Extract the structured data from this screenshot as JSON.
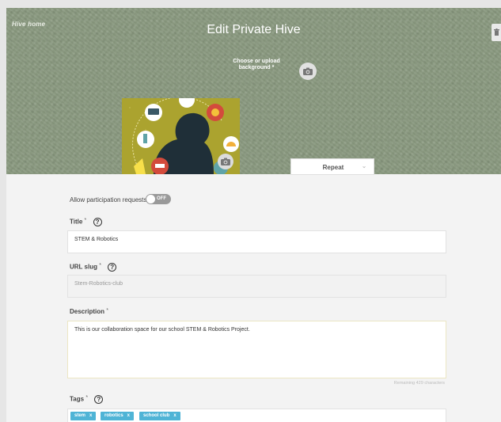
{
  "header": {
    "back_link": "Hive home",
    "title": "Edit Private Hive",
    "background_label": "Choose or upload background",
    "background_required": "*",
    "repeat_value": "Repeat"
  },
  "form": {
    "allow_participation": {
      "label": "Allow participation requests",
      "toggle_text": "OFF"
    },
    "title": {
      "label": "Title",
      "required": "*",
      "help": "?",
      "value": "STEM & Robotics"
    },
    "url_slug": {
      "label": "URL slug",
      "required": "*",
      "help": "?",
      "value": "Stem-Robotics-club"
    },
    "description": {
      "label": "Description",
      "required": "*",
      "value": "This is our collaboration space for our school STEM & Robotics Project.",
      "remaining": "Remaining 429 characters"
    },
    "tags": {
      "label": "Tags",
      "required": "*",
      "help": "?",
      "items": [
        {
          "label": "stem",
          "remove": "x"
        },
        {
          "label": "robotics",
          "remove": "x"
        },
        {
          "label": "school club",
          "remove": "x"
        }
      ]
    }
  },
  "colors": {
    "header_bg": "#8a9a80",
    "tag_bg": "#4fb4d6",
    "toggle_off": "#999999"
  },
  "icons": [
    "trash-icon",
    "camera-icon",
    "chevron-down-icon",
    "help-icon"
  ]
}
